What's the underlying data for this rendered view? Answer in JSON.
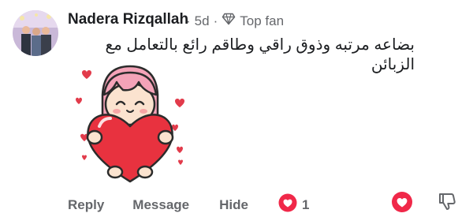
{
  "comment": {
    "author_name": "Nadera Rizqallah",
    "age": "5d",
    "separator": "·",
    "badge_label": "Top fan",
    "text": "بضاعه مرتبه وذوق راقي وطاقم رائع بالتعامل مع الزبائن"
  },
  "actions": {
    "reply_label": "Reply",
    "message_label": "Message",
    "hide_label": "Hide",
    "reaction_count": "1"
  },
  "colors": {
    "heart_red": "#f02849",
    "muted_text": "#65676b",
    "primary_text": "#1c1e21"
  },
  "icons": {
    "badge": "diamond-icon",
    "reaction": "love-reaction-icon",
    "react_button": "heart-icon",
    "dislike_button": "thumbs-down-icon"
  }
}
